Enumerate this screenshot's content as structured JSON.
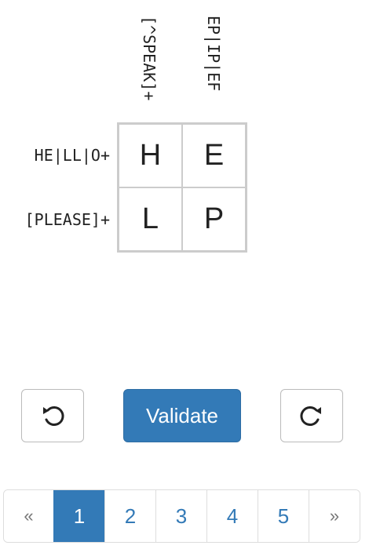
{
  "puzzle": {
    "column_clues": [
      "[^SPEAK]+",
      "EP|IP|EF"
    ],
    "row_clues": [
      "HE|LL|O+",
      "[PLEASE]+"
    ],
    "cells": [
      [
        "H",
        "E"
      ],
      [
        "L",
        "P"
      ]
    ]
  },
  "controls": {
    "undo_icon": "undo-arrow",
    "validate_label": "Validate",
    "redo_icon": "redo-arrow",
    "accent_color": "#337ab7"
  },
  "pagination": {
    "prev": "«",
    "pages": [
      "1",
      "2",
      "3",
      "4",
      "5"
    ],
    "active": "1",
    "next": "»"
  }
}
